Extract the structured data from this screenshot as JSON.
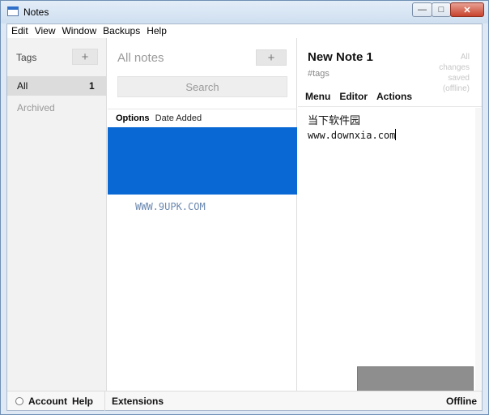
{
  "window": {
    "title": "Notes",
    "controls": {
      "minimize": "—",
      "maximize": "□",
      "close": "✕"
    }
  },
  "menubar": {
    "items": [
      "Edit",
      "View",
      "Window",
      "Backups",
      "Help"
    ]
  },
  "tags_panel": {
    "heading": "Tags",
    "add_label": "+",
    "items": [
      {
        "label": "All",
        "count": "1"
      },
      {
        "label": "Archived"
      }
    ]
  },
  "notes_panel": {
    "heading": "All notes",
    "add_label": "+",
    "search_placeholder": "Search",
    "options_label": "Options",
    "sort_label": "Date Added",
    "watermark": "WWW.9UPK.COM"
  },
  "editor": {
    "title": "New Note 1",
    "tags": "#tags",
    "save_status": [
      "All",
      "changes",
      "saved",
      "(offline)"
    ],
    "menu": [
      "Menu",
      "Editor",
      "Actions"
    ],
    "lines": [
      "当下软件园",
      "www.downxia.com"
    ]
  },
  "footer": {
    "account": "Account",
    "help": "Help",
    "extensions": "Extensions",
    "status": "Offline"
  },
  "colors": {
    "selection": "#0a68d4",
    "sidebar_bg": "#f2f2f2",
    "muted_text": "#999999"
  }
}
